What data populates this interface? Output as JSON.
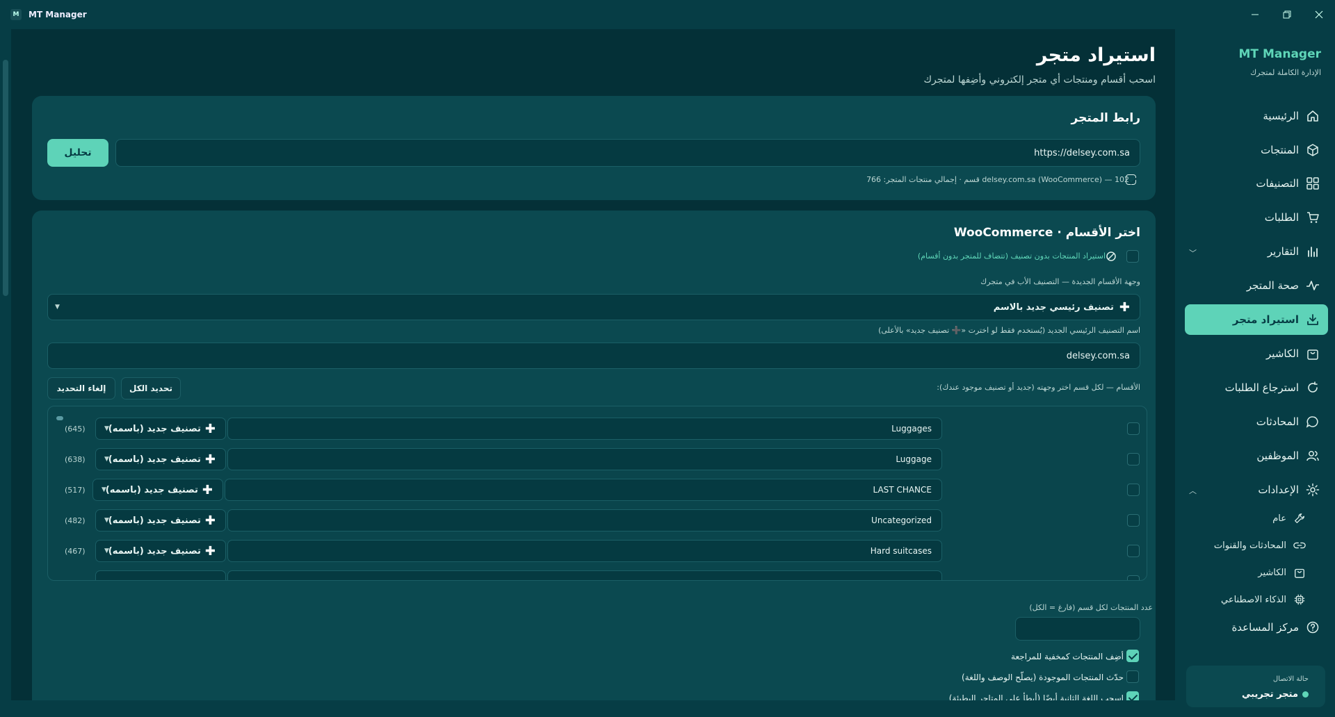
{
  "app": {
    "title": "MT Manager",
    "logo_letter": "M"
  },
  "window_controls": {
    "minimize": "—",
    "restore": "❐",
    "close": "✕"
  },
  "page": {
    "title": "استيراد متجر",
    "subtitle": "اسحب أقسام ومنتجات أي متجر إلكتروني وأضِفها لمتجرك"
  },
  "store_link": {
    "title": "رابط المتجر",
    "url_value": "https://delsey.com.sa",
    "analyze_button": "تحليل",
    "info": "delsey.com.sa (WooCommerce) — 102 قسم · إجمالي منتجات المتجر: 766"
  },
  "sections": {
    "title": "اختر الأقسام · WooCommerce",
    "import_uncategorized": "استيراد المنتجات بدون تصنيف (تتضاف للمتجر بدون أقسام)",
    "destination_label": "وجهة الأقسام الجديدة — التصنيف الأب في متجرك",
    "destination_value": "تصنيف رئيسي جديد بالاسم",
    "parent_name_label": "اسم التصنيف الرئيسي الجديد (يُستخدم فقط لو اخترت «➕ تصنيف جديد» بالأعلى)",
    "parent_name_value": "delsey.com.sa",
    "list_label": "الأقسام — لكل قسم اختر وجهته (جديد أو تصنيف موجود عندك):",
    "select_all": "تحديد الكل",
    "deselect": "إلغاء التحديد",
    "rows": [
      {
        "name": "Luggages",
        "target": "تصنيف جديد (باسمه)",
        "count": "(645)"
      },
      {
        "name": "Luggage",
        "target": "تصنيف جديد (باسمه)",
        "count": "(638)"
      },
      {
        "name": "LAST CHANCE",
        "target": "تصنيف جديد (باسمه)",
        "count": "(517)"
      },
      {
        "name": "Uncategorized",
        "target": "تصنيف جديد (باسمه)",
        "count": "(482)"
      },
      {
        "name": "Hard suitcases",
        "target": "تصنيف جديد (باسمه)",
        "count": "(467)"
      },
      {
        "name": "",
        "target": "",
        "count": ""
      }
    ],
    "per_category_label": "عدد المنتجات لكل قسم (فارغ = الكل)",
    "per_category_value": "",
    "options": [
      {
        "label": "أضِف المنتجات كمخفية للمراجعة",
        "checked": true
      },
      {
        "label": "حدّث المنتجات الموجودة (يصلّح الوصف واللغة)",
        "checked": false
      },
      {
        "label": "اسحب اللغة الثانية أيضًا (أبطأ على المتاجر البطيئة)",
        "checked": true
      }
    ]
  },
  "sidebar": {
    "brand": "MT Manager",
    "brand_sub": "الإدارة الكاملة لمتجرك",
    "items": [
      {
        "label": "الرئيسية",
        "icon": "home-icon"
      },
      {
        "label": "المنتجات",
        "icon": "box-icon"
      },
      {
        "label": "التصنيفات",
        "icon": "grid-icon"
      },
      {
        "label": "الطلبات",
        "icon": "cart-icon"
      },
      {
        "label": "التقارير",
        "icon": "chart-icon"
      },
      {
        "label": "صحة المتجر",
        "icon": "pulse-icon"
      },
      {
        "label": "استيراد متجر",
        "icon": "download-icon"
      },
      {
        "label": "الكاشير",
        "icon": "bag-icon"
      },
      {
        "label": "استرجاع الطلبات",
        "icon": "refresh-icon"
      },
      {
        "label": "المحادثات",
        "icon": "chat-icon"
      },
      {
        "label": "الموظفين",
        "icon": "users-icon"
      },
      {
        "label": "الإعدادات",
        "icon": "gear-icon"
      }
    ],
    "sub_items": [
      {
        "label": "عام",
        "icon": "wrench-icon"
      },
      {
        "label": "المحادثات والقنوات",
        "icon": "link-icon"
      },
      {
        "label": "الكاشير",
        "icon": "bag-icon"
      },
      {
        "label": "الذكاء الاصطناعي",
        "icon": "chip-icon"
      }
    ],
    "help": {
      "label": "مركز المساعدة",
      "icon": "help-icon"
    },
    "status_label": "حالة الاتصال",
    "status_value": "متجر تجريبي"
  },
  "colors": {
    "accent": "#5ed3b8",
    "background": "#043037",
    "sidebar": "#063d45",
    "card": "#0b4950"
  }
}
